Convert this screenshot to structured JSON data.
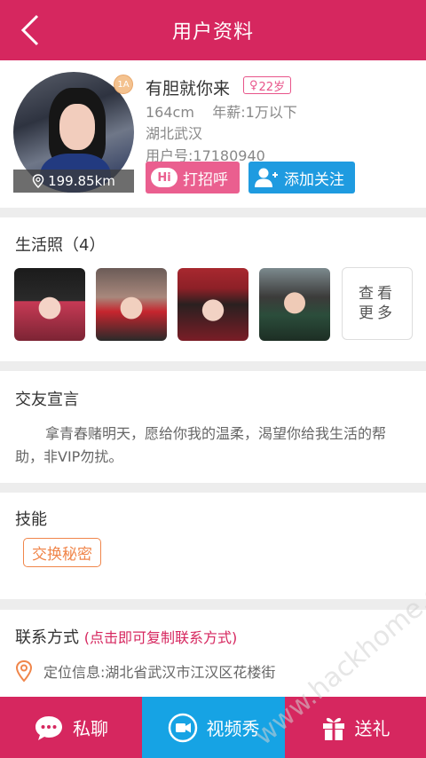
{
  "topbar": {
    "title": "用户资料"
  },
  "profile": {
    "distance": "199.85km",
    "level": "1A",
    "name": "有胆就你来",
    "age": "22岁",
    "height_salary": "164cm    年薪:1万以下",
    "location": "湖北武汉",
    "user_id": "用户号:17180940",
    "greet_button": "打招呼",
    "greet_icon_text": "Hi",
    "follow_button": "添加关注"
  },
  "photos": {
    "title": "生活照（4）",
    "more": [
      "查看",
      "更多"
    ]
  },
  "declaration": {
    "title": "交友宣言",
    "text": "拿青春赌明天，愿给你我的温柔，渴望你给我生活的帮助，非VIP勿扰。"
  },
  "skills": {
    "title": "技能",
    "tags": [
      "交换秘密"
    ]
  },
  "contact": {
    "title": "联系方式",
    "hint": "(点击即可复制联系方式)",
    "location": "定位信息:湖北省武汉市江汉区花楼街"
  },
  "bottom": {
    "chat": "私聊",
    "video": "视频秀",
    "gift": "送礼"
  },
  "watermark": "www.hackhome.com",
  "colors": {
    "brand": "#d6275f",
    "blue": "#16a3e4",
    "orange": "#f0864b"
  }
}
